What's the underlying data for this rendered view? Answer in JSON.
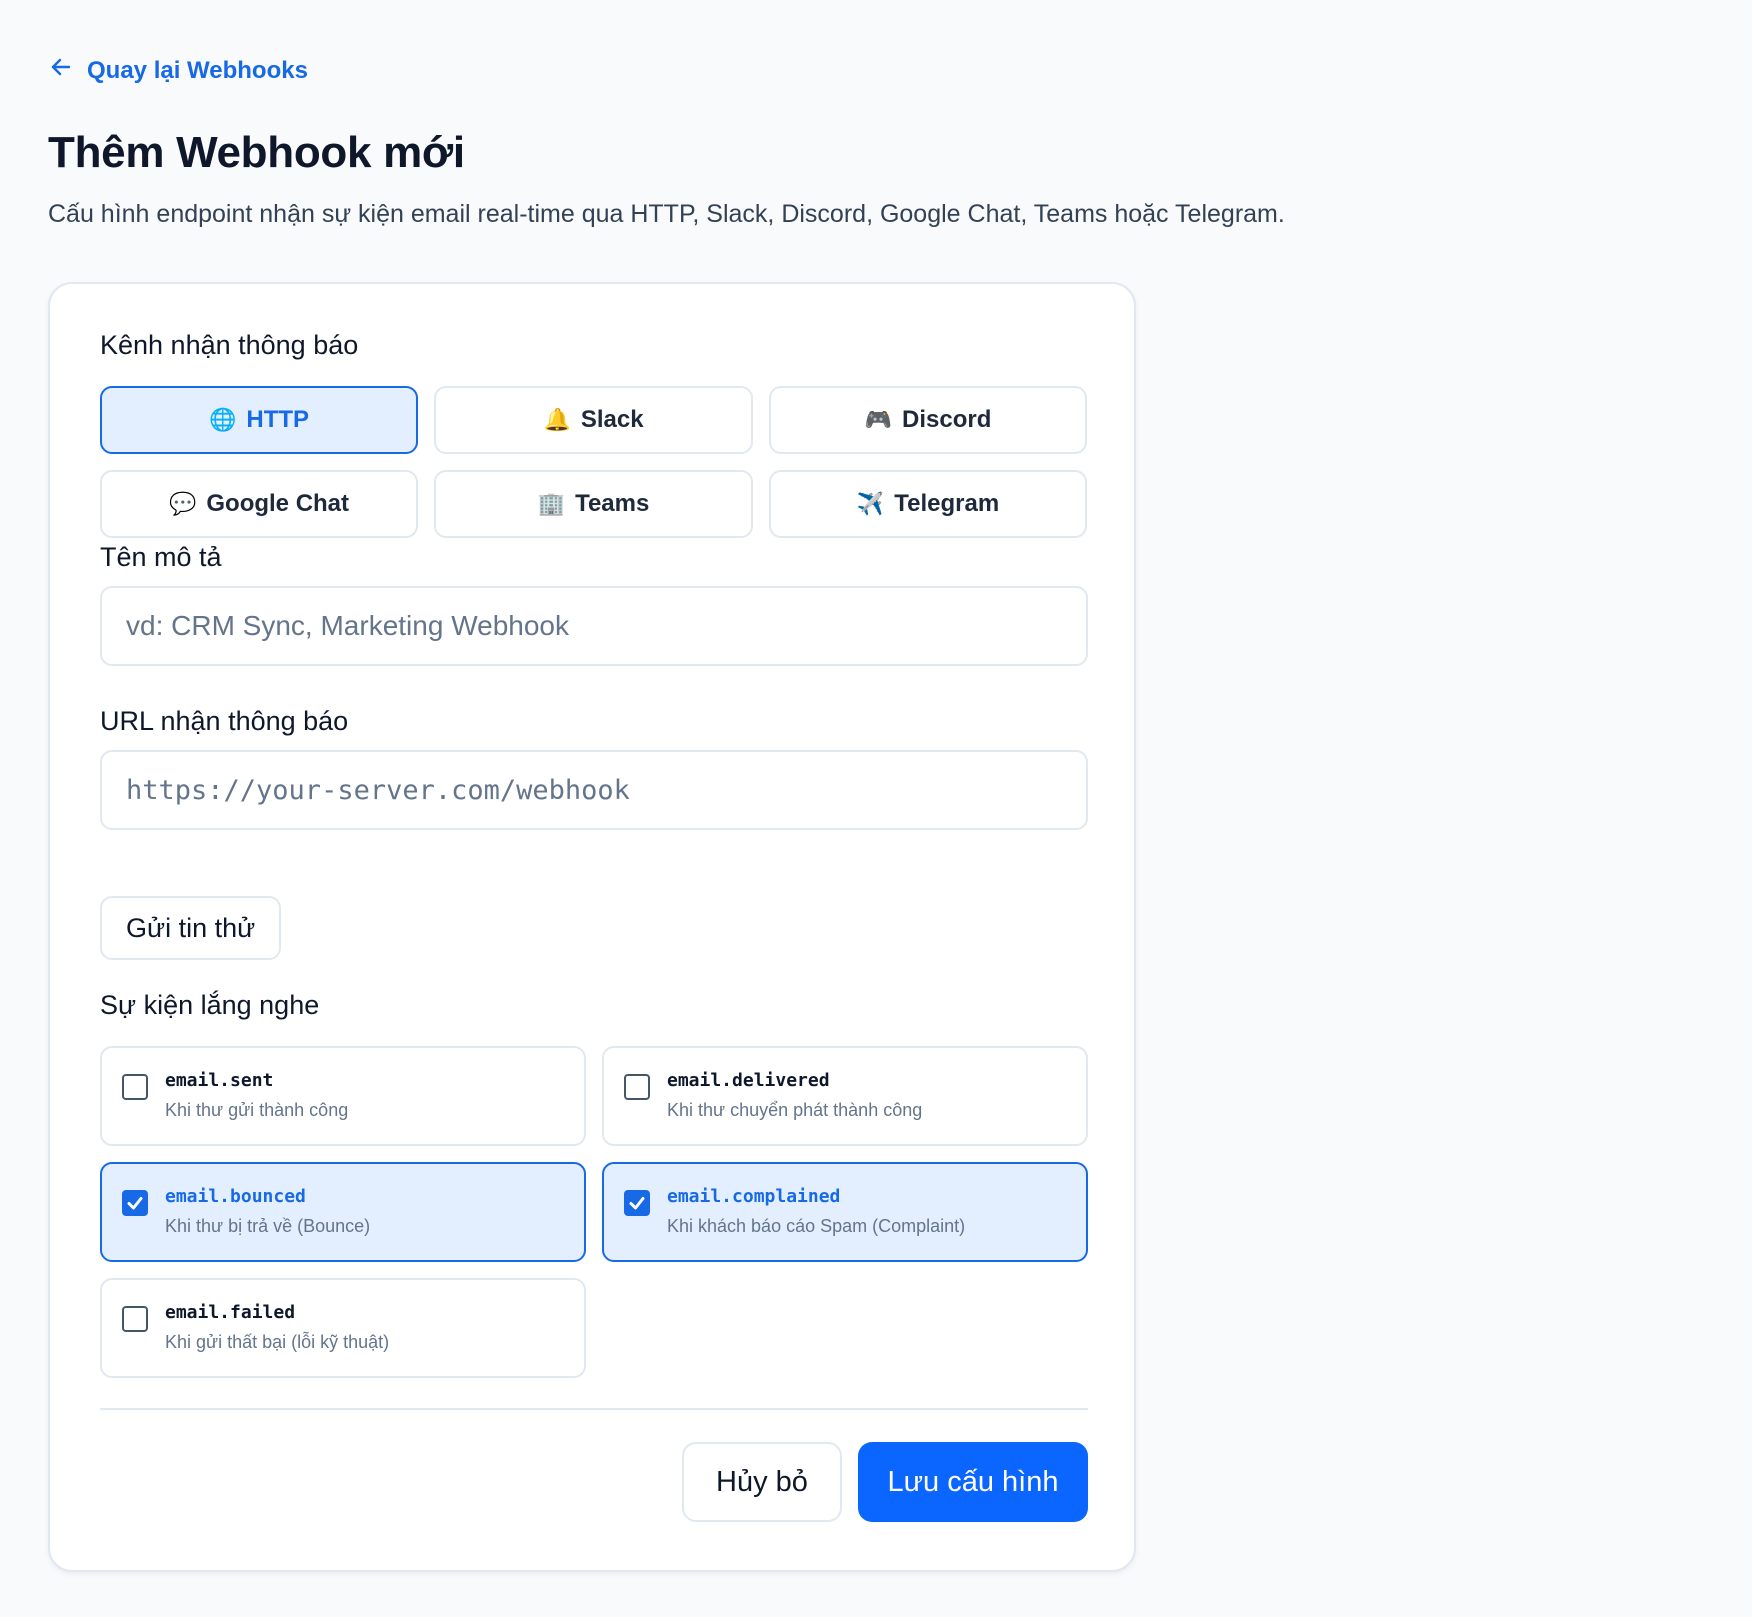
{
  "back_link": {
    "label": "Quay lại Webhooks",
    "icon": "arrow-left-icon"
  },
  "header": {
    "title": "Thêm Webhook mới",
    "subtitle": "Cấu hình endpoint nhận sự kiện email real-time qua HTTP, Slack, Discord, Google Chat, Teams hoặc Telegram."
  },
  "form": {
    "channel_label": "Kênh nhận thông báo",
    "channels": [
      {
        "label": "HTTP",
        "icon": "globe-icon",
        "emoji": "🌐",
        "active": true
      },
      {
        "label": "Slack",
        "icon": "bell-icon",
        "emoji": "🔔",
        "active": false
      },
      {
        "label": "Discord",
        "icon": "game-controller-icon",
        "emoji": "🎮",
        "active": false
      },
      {
        "label": "Google Chat",
        "icon": "speech-bubble-icon",
        "emoji": "💬",
        "active": false
      },
      {
        "label": "Teams",
        "icon": "office-building-icon",
        "emoji": "🏢",
        "active": false
      },
      {
        "label": "Telegram",
        "icon": "airplane-icon",
        "emoji": "✈️",
        "active": false
      }
    ],
    "name_label": "Tên mô tả",
    "name_value": "",
    "name_placeholder": "vd: CRM Sync, Marketing Webhook",
    "url_label": "URL nhận thông báo",
    "url_value": "",
    "url_placeholder": "https://your-server.com/webhook",
    "test_button": "Gửi tin thử",
    "events_label": "Sự kiện lắng nghe",
    "events": [
      {
        "name": "email.sent",
        "description": "Khi thư gửi thành công",
        "checked": false
      },
      {
        "name": "email.delivered",
        "description": "Khi thư chuyển phát thành công",
        "checked": false
      },
      {
        "name": "email.bounced",
        "description": "Khi thư bị trả về (Bounce)",
        "checked": true
      },
      {
        "name": "email.complained",
        "description": "Khi khách báo cáo Spam (Complaint)",
        "checked": true
      },
      {
        "name": "email.failed",
        "description": "Khi gửi thất bại (lỗi kỹ thuật)",
        "checked": false
      }
    ],
    "cancel_button": "Hủy bỏ",
    "save_button": "Lưu cấu hình"
  },
  "colors": {
    "accent": "#1769e6",
    "primary_button": "#0b66ff",
    "selected_bg": "#e3efff",
    "border": "#e2e8f0",
    "page_bg": "#f8fafc"
  }
}
